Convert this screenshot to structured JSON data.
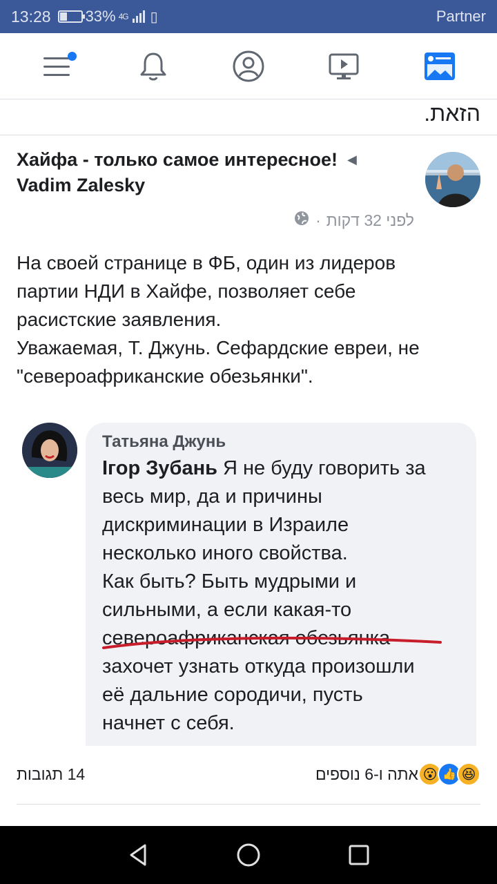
{
  "status_bar": {
    "time": "13:28",
    "battery_percent": "33%",
    "network": "4G",
    "carrier": "Partner",
    "battery_level": 0.33
  },
  "nav": {
    "items": [
      {
        "name": "menu-icon",
        "has_notification": true
      },
      {
        "name": "bell-icon"
      },
      {
        "name": "profile-icon"
      },
      {
        "name": "watch-icon"
      },
      {
        "name": "news-feed-icon"
      }
    ],
    "accent": "#1877f2"
  },
  "prev_post": {
    "tail_text": "הזאת."
  },
  "post": {
    "group_name": "Хайфа - только самое интересное!",
    "author_name": "Vadim Zalesky",
    "timestamp": "לפני 32 דקות",
    "privacy_icon": "globe-icon",
    "text_lines": [
      "На своей странице в ФБ, один  из лидеров",
      "партии НДИ в Хайфе, позволяет себе",
      "расистские заявления.",
      "Уважаемая, Т. Джунь. Сефардские евреи, не",
      "\"североафриканские  обезьянки\"."
    ]
  },
  "embedded_comment": {
    "author": "Татьяна Джунь",
    "mention": "Ігор Зубань",
    "lines": [
      " Я не буду говорить за",
      "весь мир, да и причины",
      "дискриминации в Израиле",
      "несколько иного свойства.",
      "Как быть? Быть мудрыми и",
      "сильными, а если какая-то",
      "североафриканская обезьянка",
      "захочет узнать откуда произошли",
      "её дальние сородичи, пусть",
      "начнет с себя."
    ]
  },
  "reactions": {
    "summary": "אתה ו-6 נוספים",
    "comments": "14 תגובות",
    "icons": [
      "wow-icon",
      "like-icon",
      "haha-icon"
    ]
  }
}
